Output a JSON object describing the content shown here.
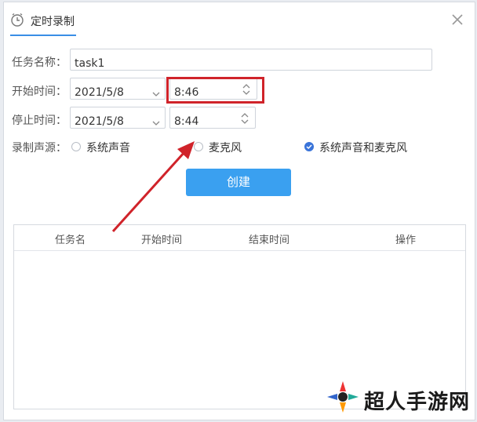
{
  "dialog": {
    "title": "定时录制",
    "close_icon": "close-icon",
    "title_icon": "clock-icon"
  },
  "form": {
    "task_name_label": "任务名称：",
    "task_name_value": "task1",
    "start_label": "开始时间：",
    "start_date": "2021/5/8",
    "start_time": "8:46",
    "stop_label": "停止时间：",
    "stop_date": "2021/5/8",
    "stop_time": "8:44",
    "source_label": "录制声源：",
    "sources": [
      {
        "label": "系统声音",
        "checked": false
      },
      {
        "label": "麦克风",
        "checked": false
      },
      {
        "label": "系统声音和麦克风",
        "checked": true
      }
    ],
    "create_label": "创建"
  },
  "table": {
    "headers": [
      "任务名",
      "开始时间",
      "结束时间",
      "操作"
    ],
    "rows": []
  },
  "watermark": {
    "text": "超人手游网"
  },
  "colors": {
    "accent": "#3aa0f0",
    "annotation": "#d0232a",
    "radio_checked": "#3a74d9"
  }
}
